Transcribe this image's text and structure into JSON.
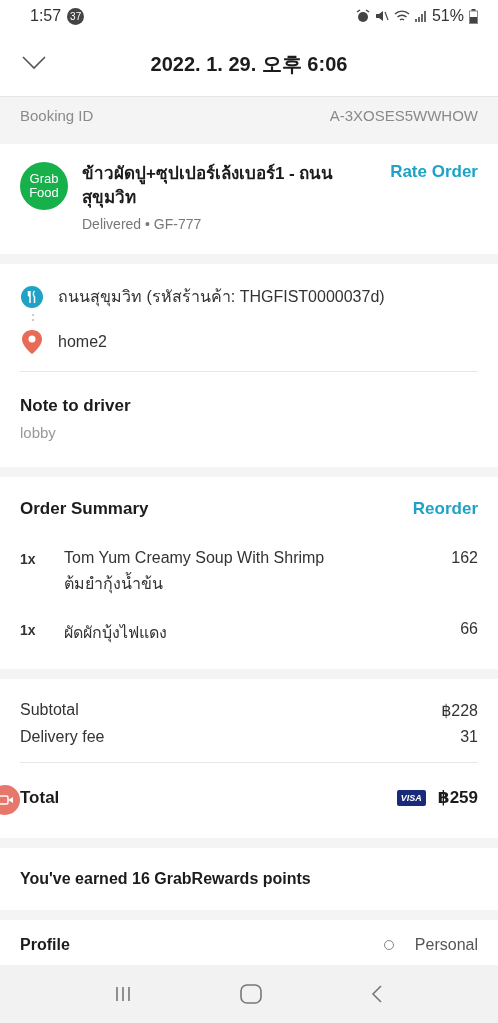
{
  "status_bar": {
    "time": "1:57",
    "notification_count": "37",
    "battery": "51%"
  },
  "header": {
    "title": "2022. 1. 29. 오후 6:06"
  },
  "booking": {
    "label": "Booking ID",
    "value": "A-3XOSES5WWHOW"
  },
  "restaurant": {
    "logo_lines": [
      "Grab",
      "Food"
    ],
    "name": "ข้าวผัดปู+ซุปเปอร์เล้งเบอร์1 - ถนนสุขุมวิท",
    "status": "Delivered • GF-777",
    "action": "Rate Order"
  },
  "route": [
    {
      "kind": "restaurant",
      "text": "ถนนสุขุมวิท (รหัสร้านค้า: THGFIST0000037d)"
    },
    {
      "kind": "destination",
      "text": "home2"
    }
  ],
  "note": {
    "label": "Note to driver",
    "value": "lobby"
  },
  "order_summary": {
    "title": "Order Summary",
    "action": "Reorder",
    "items": [
      {
        "qty": "1x",
        "name_lines": [
          "Tom Yum Creamy Soup With Shrimp",
          "ต้มยำกุ้งน้ำข้น"
        ],
        "price": "162"
      },
      {
        "qty": "1x",
        "name_lines": [
          "ผัดผักบุ้งไฟแดง"
        ],
        "price": "66"
      }
    ]
  },
  "charges": [
    {
      "label": "Subtotal",
      "value": "฿228"
    },
    {
      "label": "Delivery fee",
      "value": "31"
    }
  ],
  "total": {
    "label": "Total",
    "card_brand": "VISA",
    "value": "฿259"
  },
  "rewards": {
    "text": "You've earned 16 GrabRewards points"
  },
  "profile": {
    "label": "Profile",
    "value": "Personal"
  }
}
